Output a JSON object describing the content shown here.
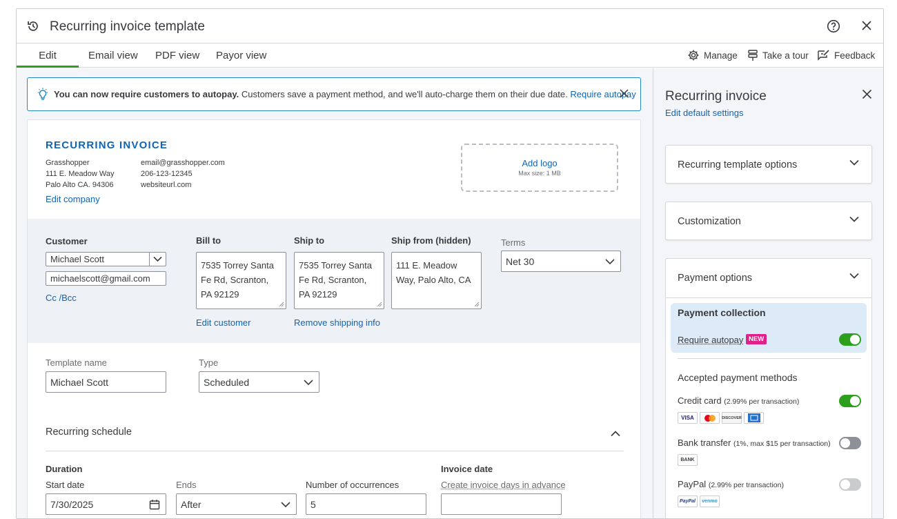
{
  "titlebar": {
    "title": "Recurring invoice template"
  },
  "tabs": [
    {
      "label": "Edit",
      "active": true
    },
    {
      "label": "Email view"
    },
    {
      "label": "PDF view"
    },
    {
      "label": "Payor view"
    }
  ],
  "toolbar": {
    "manage": "Manage",
    "tour": "Take a tour",
    "feedback": "Feedback"
  },
  "banner": {
    "bold": "You can now require customers to autopay.",
    "text": " Customers save a payment method, and we'll auto-charge them on their due date. ",
    "link": "Require autopay"
  },
  "invoice": {
    "heading": "RECURRING INVOICE",
    "company": {
      "name": "Grasshopper",
      "street": "111 E. Meadow Way",
      "city": "Palo Alto CA. 94306"
    },
    "contact": {
      "email": "email@grasshopper.com",
      "phone": "206-123-12345",
      "web": "websiteurl.com"
    },
    "edit_company": "Edit company",
    "logo": {
      "add": "Add logo",
      "max": "Max size: 1 MB"
    }
  },
  "customer": {
    "label": "Customer",
    "name": "Michael Scott",
    "email": "michaelscott@gmail.com",
    "ccbcc": "Cc /Bcc",
    "bill_to_label": "Bill to",
    "bill_to": "7535 Torrey Santa Fe Rd, Scranton, PA 92129",
    "ship_to_label": "Ship to",
    "ship_to": "7535 Torrey Santa Fe Rd, Scranton, PA 92129",
    "ship_from_label": "Ship from (hidden)",
    "ship_from": "111 E. Meadow Way, Palo Alto, CA",
    "edit_customer": "Edit customer",
    "remove_shipping": "Remove shipping info",
    "terms_label": "Terms",
    "terms": "Net 30"
  },
  "template": {
    "name_label": "Template name",
    "name": "Michael Scott",
    "type_label": "Type",
    "type": "Scheduled"
  },
  "schedule": {
    "title": "Recurring schedule",
    "duration": "Duration",
    "start_label": "Start date",
    "start": "7/30/2025",
    "ends_label": "Ends",
    "ends": "After",
    "occ_label": "Number of occurrences",
    "occ": "5",
    "invoice_date": "Invoice date",
    "advance_label": "Create invoice days in advance"
  },
  "panel": {
    "title": "Recurring invoice",
    "edit_defaults": "Edit default settings",
    "sections": [
      "Recurring template options",
      "Customization",
      "Payment options"
    ],
    "collection_title": "Payment collection",
    "require_autopay": "Require autopay",
    "new_badge": "NEW",
    "methods_title": "Accepted payment methods",
    "methods": [
      {
        "name": "Credit card",
        "fee": "(2.99% per transaction)"
      },
      {
        "name": "Bank transfer",
        "fee": "(1%, max $15 per transaction)"
      },
      {
        "name": "PayPal",
        "fee": "(2.99% per transaction)"
      }
    ],
    "logos": {
      "visa": "VISA",
      "discover": "DISCOVER",
      "bank": "BANK",
      "paypal": "PayPal",
      "venmo": "venmo"
    }
  },
  "colors": {
    "accent": "#2ca01c",
    "link": "#0f64b4",
    "badge": "#e0218a",
    "banner_border": "#1e88c7"
  }
}
